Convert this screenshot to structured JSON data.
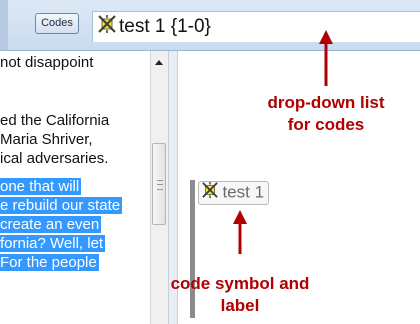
{
  "toolbar": {
    "codes_button": "Codes",
    "codes_field_value": "test 1 {1-0}"
  },
  "document": {
    "lines": [
      {
        "text": "not disappoint",
        "selected": false
      },
      {
        "text": "ed the California",
        "selected": false
      },
      {
        "text": "Maria Shriver,",
        "selected": false
      },
      {
        "text": "ical adversaries.",
        "selected": false
      },
      {
        "text": "one that will",
        "selected": true
      },
      {
        "text": "e rebuild our state",
        "selected": true
      },
      {
        "text": " create an even",
        "selected": true
      },
      {
        "text": "fornia? Well, let",
        "selected": true
      },
      {
        "text": "For the people",
        "selected": true
      }
    ]
  },
  "margin": {
    "code_label": "test 1"
  },
  "annotations": {
    "dropdown_line1": "drop-down list",
    "dropdown_line2": "for codes",
    "symbol_line1": "code symbol and",
    "symbol_line2": "label"
  },
  "colors": {
    "annotation": "#b00000",
    "selection": "#3399ff",
    "code_symbol": "#f2e23a"
  },
  "icons": {
    "code_symbol": "code-symbol-icon",
    "scroll_up": "scroll-up-arrow-icon"
  }
}
